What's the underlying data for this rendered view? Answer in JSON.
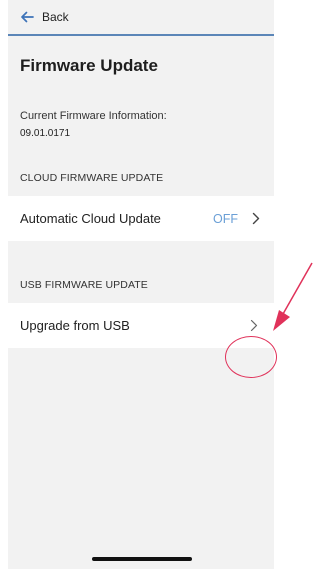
{
  "topbar": {
    "back_label": "Back"
  },
  "page": {
    "title": "Firmware Update"
  },
  "firmware": {
    "info_label": "Current Firmware Information:",
    "version": "09.01.0171"
  },
  "cloud_section": {
    "header": "CLOUD FIRMWARE UPDATE",
    "row_label": "Automatic Cloud Update",
    "row_status": "OFF"
  },
  "usb_section": {
    "header": "USB FIRMWARE UPDATE",
    "row_label": "Upgrade from USB"
  },
  "colors": {
    "accent": "#5b86b8",
    "status_text": "#6a9fd6",
    "annotation": "#e0325a",
    "background": "#f2f2f2"
  },
  "icons": [
    "back-arrow-icon",
    "chevron-right-icon",
    "annotation-arrow-icon",
    "annotation-circle-icon"
  ]
}
